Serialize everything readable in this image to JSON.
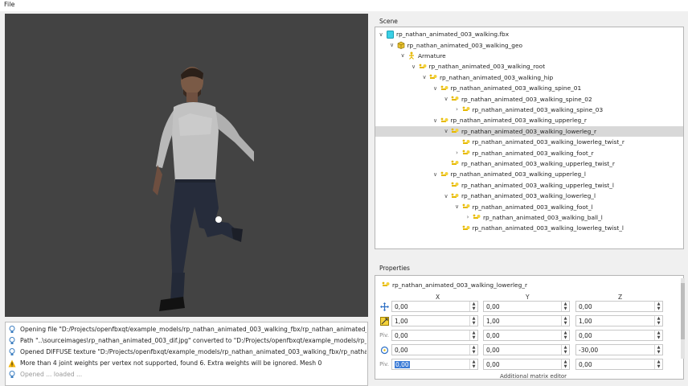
{
  "menubar": {
    "file": "File"
  },
  "viewport": {
    "background": "#434343"
  },
  "log": {
    "entries": [
      {
        "type": "info",
        "text": "Opening file \"D:/Projects/openfbxqt/example_models/rp_nathan_animated_003_walking_fbx/rp_nathan_animated_003_"
      },
      {
        "type": "info",
        "text": "Path \"..\\sourceimages\\rp_nathan_animated_003_dif.jpg\" converted to \"D:/Projects/openfbxqt/example_models/rp_nath"
      },
      {
        "type": "info",
        "text": "Opened DIFFUSE texture \"D:/Projects/openfbxqt/example_models/rp_nathan_animated_003_walking_fbx/rp_nathan_animat"
      },
      {
        "type": "warning",
        "text": "More than 4 joint weights per vertex not supported, found 6. Extra weights will be ignored. Mesh 0"
      },
      {
        "type": "info",
        "text": "Opened ... loaded ..."
      }
    ]
  },
  "scene": {
    "label": "Scene",
    "items": [
      {
        "label": "rp_nathan_animated_003_walking.fbx",
        "depth": 0,
        "expander": "open",
        "icon": "file-icon",
        "selected": false
      },
      {
        "label": "rp_nathan_animated_003_walking_geo",
        "depth": 1,
        "expander": "open",
        "icon": "mesh-icon",
        "selected": false
      },
      {
        "label": "Armature",
        "depth": 2,
        "expander": "open",
        "icon": "armature-icon",
        "selected": false
      },
      {
        "label": "rp_nathan_animated_003_walking_root",
        "depth": 3,
        "expander": "open",
        "icon": "bone-icon",
        "selected": false
      },
      {
        "label": "rp_nathan_animated_003_walking_hip",
        "depth": 4,
        "expander": "open",
        "icon": "bone-icon",
        "selected": false
      },
      {
        "label": "rp_nathan_animated_003_walking_spine_01",
        "depth": 5,
        "expander": "open",
        "icon": "bone-icon",
        "selected": false
      },
      {
        "label": "rp_nathan_animated_003_walking_spine_02",
        "depth": 6,
        "expander": "open",
        "icon": "bone-icon",
        "selected": false
      },
      {
        "label": "rp_nathan_animated_003_walking_spine_03",
        "depth": 7,
        "expander": "closed",
        "icon": "bone-icon",
        "selected": false
      },
      {
        "label": "rp_nathan_animated_003_walking_upperleg_r",
        "depth": 5,
        "expander": "open",
        "icon": "bone-icon",
        "selected": false
      },
      {
        "label": "rp_nathan_animated_003_walking_lowerleg_r",
        "depth": 6,
        "expander": "open",
        "icon": "bone-icon",
        "selected": true
      },
      {
        "label": "rp_nathan_animated_003_walking_lowerleg_twist_r",
        "depth": 7,
        "expander": "none",
        "icon": "bone-icon",
        "selected": false
      },
      {
        "label": "rp_nathan_animated_003_walking_foot_r",
        "depth": 7,
        "expander": "closed",
        "icon": "bone-icon",
        "selected": false
      },
      {
        "label": "rp_nathan_animated_003_walking_upperleg_twist_r",
        "depth": 6,
        "expander": "none",
        "icon": "bone-icon",
        "selected": false
      },
      {
        "label": "rp_nathan_animated_003_walking_upperleg_l",
        "depth": 5,
        "expander": "open",
        "icon": "bone-icon",
        "selected": false
      },
      {
        "label": "rp_nathan_animated_003_walking_upperleg_twist_l",
        "depth": 6,
        "expander": "none",
        "icon": "bone-icon",
        "selected": false
      },
      {
        "label": "rp_nathan_animated_003_walking_lowerleg_l",
        "depth": 6,
        "expander": "open",
        "icon": "bone-icon",
        "selected": false
      },
      {
        "label": "rp_nathan_animated_003_walking_foot_l",
        "depth": 7,
        "expander": "open",
        "icon": "bone-icon",
        "selected": false
      },
      {
        "label": "rp_nathan_animated_003_walking_ball_l",
        "depth": 8,
        "expander": "closed",
        "icon": "bone-icon",
        "selected": false
      },
      {
        "label": "rp_nathan_animated_003_walking_lowerleg_twist_l",
        "depth": 7,
        "expander": "none",
        "icon": "bone-icon",
        "selected": false
      }
    ]
  },
  "properties": {
    "label": "Properties",
    "title": "rp_nathan_animated_003_walking_lowerleg_r",
    "axes": [
      "X",
      "Y",
      "Z"
    ],
    "rows": [
      {
        "name": "translation",
        "icon": "move-icon",
        "prefix": "",
        "values": [
          "0,00",
          "0,00",
          "0,00"
        ]
      },
      {
        "name": "scale",
        "icon": "scale-icon",
        "prefix": "",
        "values": [
          "1,00",
          "1,00",
          "1,00"
        ]
      },
      {
        "name": "pivot",
        "icon": "",
        "prefix": "Piv.",
        "values": [
          "0,00",
          "0,00",
          "0,00"
        ]
      },
      {
        "name": "rotation",
        "icon": "rotate-icon",
        "prefix": "",
        "values": [
          "0,00",
          "0,00",
          "-30,00"
        ]
      },
      {
        "name": "rotation-pivot",
        "icon": "",
        "prefix": "Piv.",
        "values": [
          "0,00",
          "0,00",
          "0,00"
        ]
      }
    ],
    "footer": "Additional matrix editor"
  }
}
